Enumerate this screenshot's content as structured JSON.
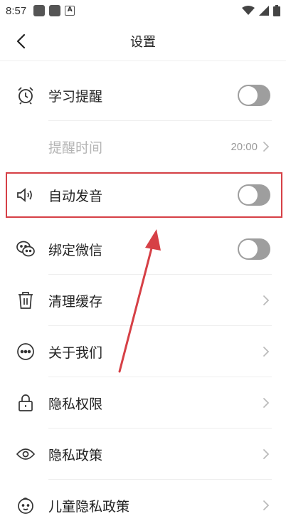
{
  "status_bar": {
    "time": "8:57",
    "notification_badge": "A"
  },
  "header": {
    "title": "设置"
  },
  "settings": [
    {
      "label": "学习提醒",
      "icon": "alarm-clock-icon",
      "control": "toggle",
      "enabled": false
    },
    {
      "label": "提醒时间",
      "value": "20:00",
      "control": "chevron",
      "muted": true
    },
    {
      "label": "自动发音",
      "icon": "speaker-icon",
      "control": "toggle",
      "enabled": false,
      "highlighted": true
    },
    {
      "label": "绑定微信",
      "icon": "wechat-icon",
      "control": "toggle",
      "enabled": false
    },
    {
      "label": "清理缓存",
      "icon": "trash-icon",
      "control": "chevron"
    },
    {
      "label": "关于我们",
      "icon": "more-dots-icon",
      "control": "chevron"
    },
    {
      "label": "隐私权限",
      "icon": "lock-icon",
      "control": "chevron"
    },
    {
      "label": "隐私政策",
      "icon": "eye-icon",
      "control": "chevron"
    },
    {
      "label": "儿童隐私政策",
      "icon": "child-face-icon",
      "control": "chevron"
    }
  ],
  "colors": {
    "highlight": "#d64046",
    "toggle_off": "#9e9e9e"
  }
}
